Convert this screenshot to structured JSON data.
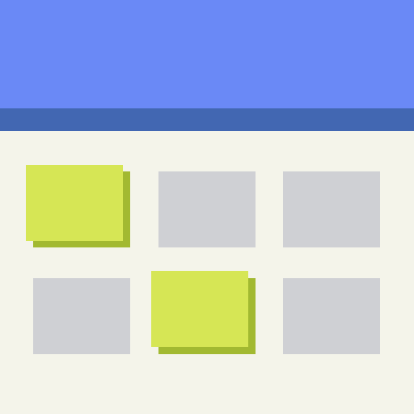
{
  "icon": {
    "name": "calendar-icon",
    "colors": {
      "header": "#6a89f6",
      "header_stripe": "#4267b2",
      "background": "#f4f4ea",
      "cell_plain": "#cfd0d4",
      "cell_highlight": "#d6e655",
      "cell_highlight_shadow": "#a2b931"
    },
    "grid": {
      "rows": 2,
      "columns": 3,
      "highlighted_cells": [
        {
          "row": 1,
          "column": 1
        },
        {
          "row": 2,
          "column": 2
        }
      ]
    }
  }
}
